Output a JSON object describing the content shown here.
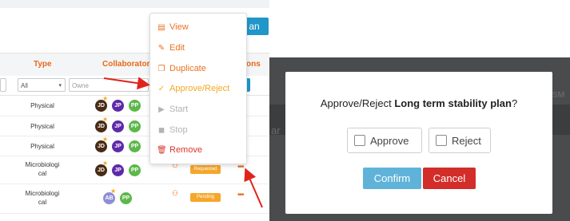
{
  "left": {
    "top_button_label": "an",
    "headers": {
      "type": "Type",
      "collaborators": "Collaborators",
      "actions": "ons"
    },
    "filters": {
      "type_value": "All",
      "owner_placeholder": "Owne"
    },
    "rows": [
      {
        "type": "Physical",
        "status": "",
        "avatars": [
          "JD",
          "JP",
          "PP"
        ]
      },
      {
        "type": "Physical",
        "status": "",
        "avatars": [
          "JD",
          "JP",
          "PP"
        ]
      },
      {
        "type": "Physical",
        "status": "",
        "avatars": [
          "JD",
          "JP",
          "PP"
        ]
      },
      {
        "type_line1": "Microbiologi",
        "type_line2": "cal",
        "status": "Requested",
        "avatars": [
          "JD",
          "JP",
          "PP"
        ]
      },
      {
        "type_line1": "Microbiologi",
        "type_line2": "cal",
        "status": "Pending",
        "avatars": [
          "AB",
          "PP"
        ]
      }
    ],
    "menu": [
      {
        "label": "View",
        "icon": "document-icon"
      },
      {
        "label": "Edit",
        "icon": "edit-icon"
      },
      {
        "label": "Duplicate",
        "icon": "duplicate-icon"
      },
      {
        "label": "Approve/Reject",
        "icon": "check-circle-icon"
      },
      {
        "label": "Start",
        "icon": "play-icon"
      },
      {
        "label": "Stop",
        "icon": "stop-icon"
      },
      {
        "label": "Remove",
        "icon": "trash-icon"
      }
    ],
    "colors": {
      "accent": "#e66a18",
      "avatar_dark": "#4a2a14",
      "avatar_purple": "#5d2aa8",
      "avatar_green": "#5cb84a",
      "avatar_lilac": "#8e8ed6",
      "status": "#f6a62b",
      "arrow": "#e0241b"
    }
  },
  "modal": {
    "question_prefix": "Approve/Reject ",
    "plan_name": "Long term stability plan",
    "question_suffix": "?",
    "approve_label": "Approve",
    "reject_label": "Reject",
    "confirm_label": "Confirm",
    "cancel_label": "Cancel",
    "peek_text_1": "sм",
    "peek_text_2": "ar",
    "colors": {
      "confirm": "#5fb3d9",
      "cancel": "#d32d2a"
    }
  }
}
